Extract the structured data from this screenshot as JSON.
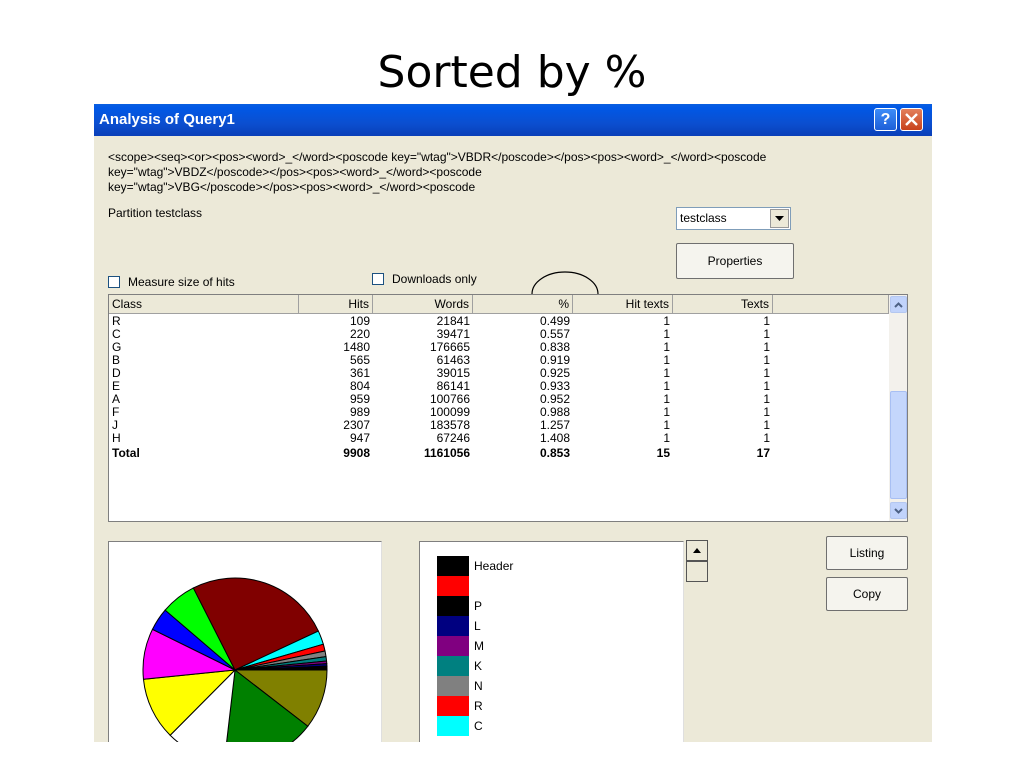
{
  "slide_title": "Sorted by %",
  "window": {
    "title": "Analysis of Query1",
    "help_label": "?",
    "query_lines": [
      "<scope><seq><or><pos><word>_</word><poscode key=\"wtag\">VBDR</poscode></pos><pos><word>_</word><poscode",
      "key=\"wtag\">VBDZ</poscode></pos><pos><word>_</word><poscode",
      "key=\"wtag\">VBG</poscode></pos><pos><word>_</word><poscode"
    ],
    "partition_label": "Partition testclass",
    "partition_select": "testclass",
    "properties_label": "Properties",
    "measure_label": "Measure size of hits",
    "downloads_label": "Downloads only",
    "listing_label": "Listing",
    "copy_label": "Copy"
  },
  "table": {
    "headers": [
      "Class",
      "Hits",
      "Words",
      "%",
      "Hit texts",
      "Texts"
    ],
    "rows": [
      [
        "R",
        "109",
        "21841",
        "0.499",
        "1",
        "1"
      ],
      [
        "C",
        "220",
        "39471",
        "0.557",
        "1",
        "1"
      ],
      [
        "G",
        "1480",
        "176665",
        "0.838",
        "1",
        "1"
      ],
      [
        "B",
        "565",
        "61463",
        "0.919",
        "1",
        "1"
      ],
      [
        "D",
        "361",
        "39015",
        "0.925",
        "1",
        "1"
      ],
      [
        "E",
        "804",
        "86141",
        "0.933",
        "1",
        "1"
      ],
      [
        "A",
        "959",
        "100766",
        "0.952",
        "1",
        "1"
      ],
      [
        "F",
        "989",
        "100099",
        "0.988",
        "1",
        "1"
      ],
      [
        "J",
        "2307",
        "183578",
        "1.257",
        "1",
        "1"
      ],
      [
        "H",
        "947",
        "67246",
        "1.408",
        "1",
        "1"
      ]
    ],
    "total": [
      "Total",
      "9908",
      "1161056",
      "0.853",
      "15",
      "17"
    ]
  },
  "legend": [
    {
      "label": "Header",
      "color": "#000000"
    },
    {
      "label": "",
      "color": "#ff0000"
    },
    {
      "label": "P",
      "color": "#000000"
    },
    {
      "label": "L",
      "color": "#000080"
    },
    {
      "label": "M",
      "color": "#800080"
    },
    {
      "label": "K",
      "color": "#008080"
    },
    {
      "label": "N",
      "color": "#808080"
    },
    {
      "label": "R",
      "color": "#ff0000"
    },
    {
      "label": "C",
      "color": "#00ffff"
    }
  ],
  "pie_colors": {
    "G": "#008000",
    "J": "#800000",
    "H": "#808000",
    "A": "#ffffff",
    "F": "#ffff00",
    "E": "#ff00ff",
    "D": "#0000ff",
    "B": "#00ff00",
    "C": "#00ffff",
    "R": "#ff0000",
    "N": "#808080",
    "K": "#008080",
    "M": "#800080",
    "L": "#000080",
    "P": "#000000"
  }
}
